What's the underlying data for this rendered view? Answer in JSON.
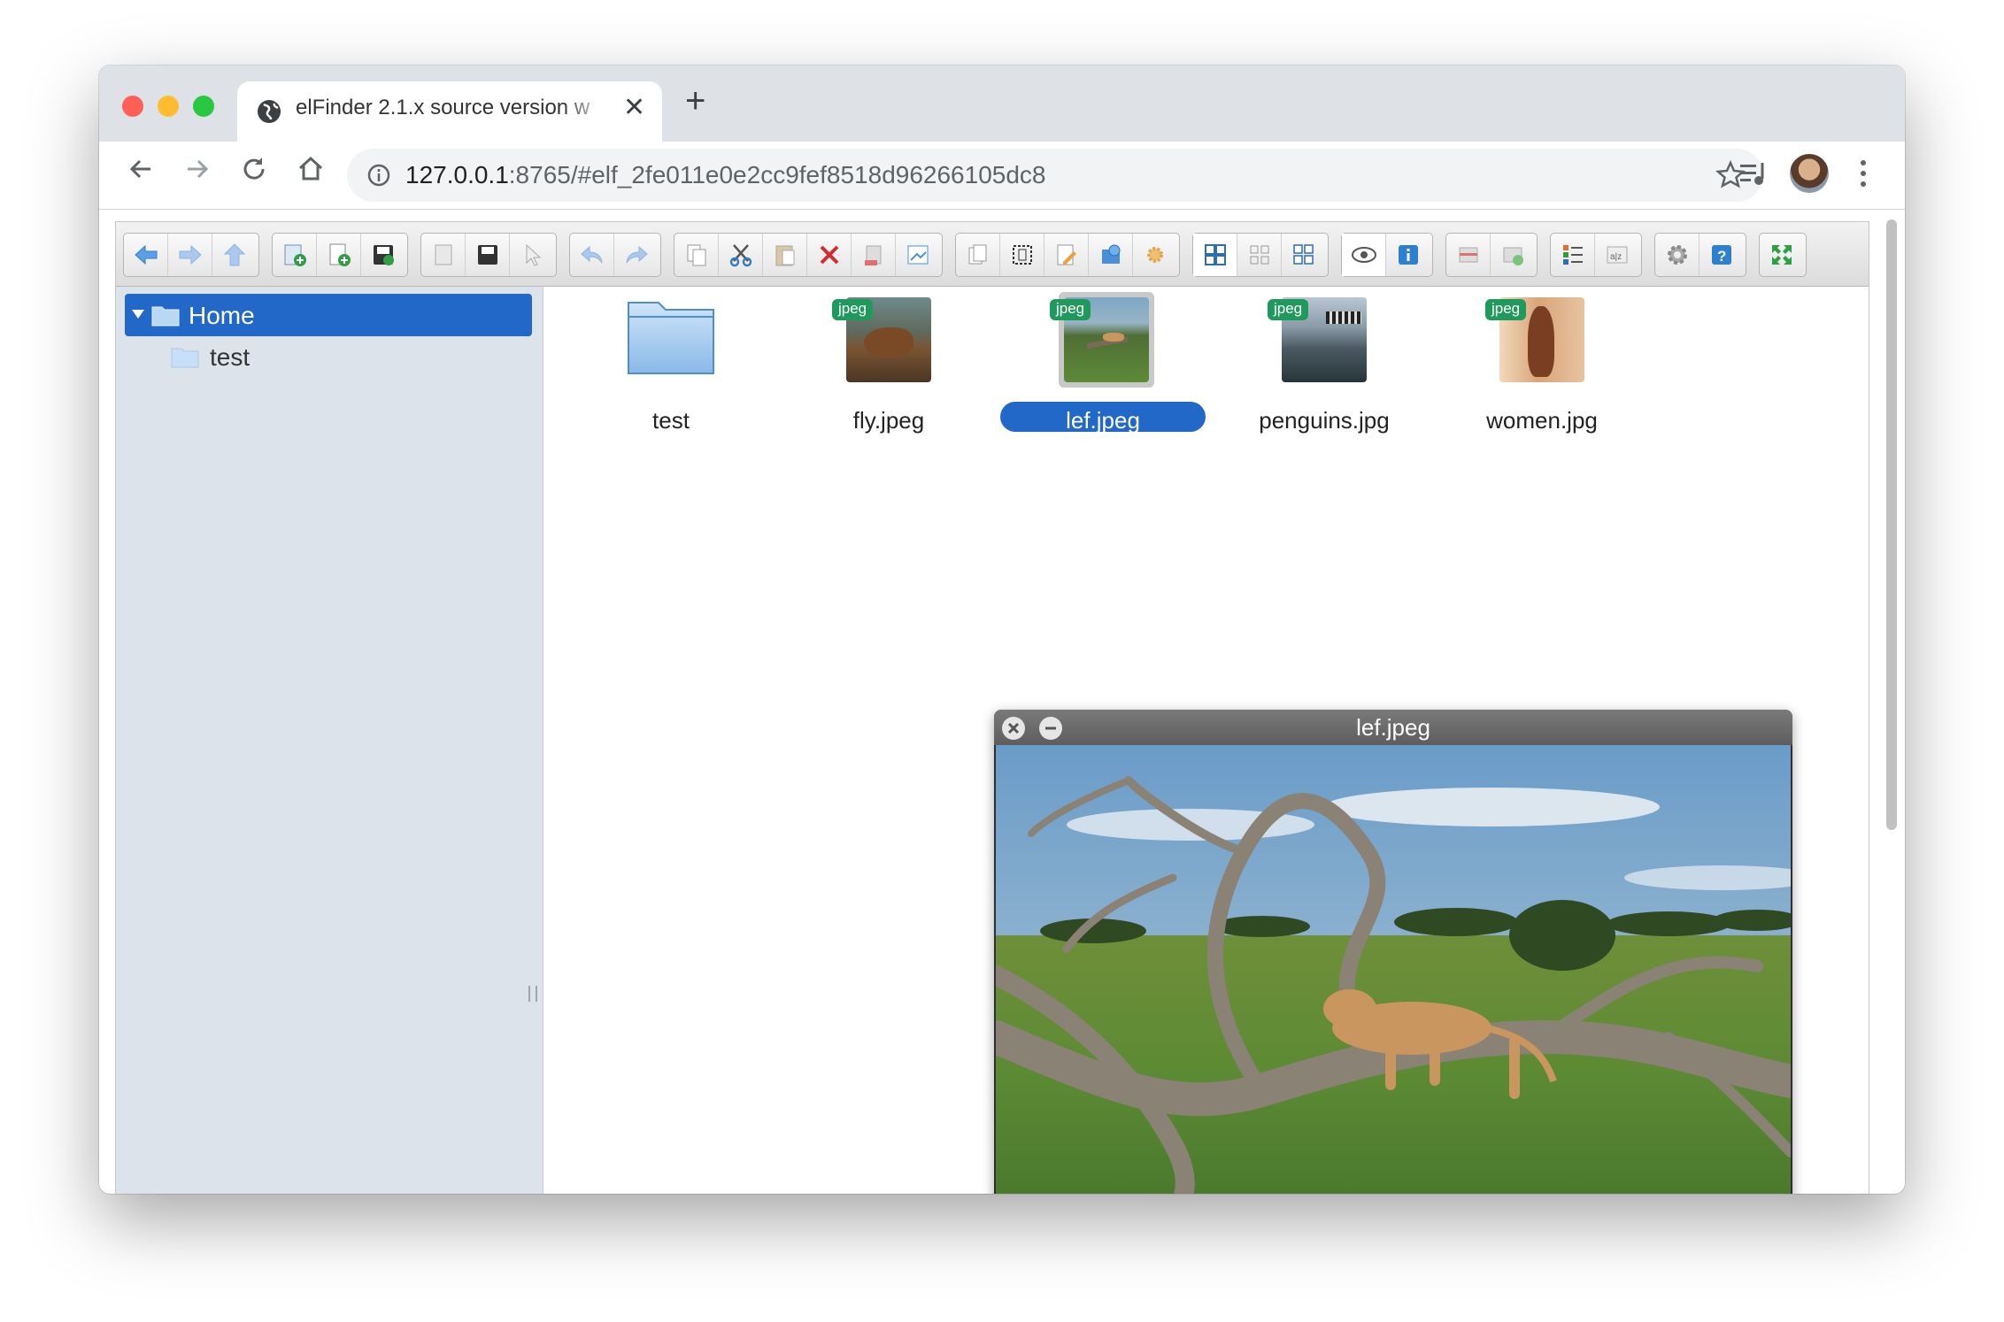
{
  "browser": {
    "tab_title": "elFinder 2.1.x source version w",
    "url_host": "127.0.0.1",
    "url_rest": ":8765/#elf_2fe011e0e2cc9fef8518d96266105dc8",
    "traffic_colors": [
      "#ff5f57",
      "#febc2e",
      "#28c840"
    ]
  },
  "toolbar": {
    "groups": [
      {
        "name": "history",
        "buttons": [
          "back-icon",
          "forward-icon",
          "up-icon"
        ]
      },
      {
        "name": "file",
        "buttons": [
          "mkdir-icon",
          "mkfile-icon",
          "upload-icon"
        ]
      },
      {
        "name": "open",
        "buttons": [
          "open-icon",
          "download-icon",
          "getfile-icon"
        ]
      },
      {
        "name": "undo",
        "buttons": [
          "undo-icon",
          "redo-icon"
        ]
      },
      {
        "name": "edit",
        "buttons": [
          "copy-icon",
          "cut-icon",
          "paste-icon",
          "delete-icon",
          "empty-icon",
          "hide-icon"
        ]
      },
      {
        "name": "tools",
        "buttons": [
          "duplicate-icon",
          "selectall-icon",
          "edit-icon",
          "netmount-icon",
          "resize-icon"
        ]
      },
      {
        "name": "view",
        "buttons": [
          "view-icons-icon",
          "view-small-icon",
          "view-list-icon"
        ]
      },
      {
        "name": "info",
        "buttons": [
          "quicklook-icon",
          "info-icon"
        ]
      },
      {
        "name": "archive",
        "buttons": [
          "extract-icon",
          "archive-icon"
        ]
      },
      {
        "name": "sort",
        "buttons": [
          "view-list-icon",
          "sort-icon"
        ]
      },
      {
        "name": "help",
        "buttons": [
          "preference-icon",
          "help-icon"
        ]
      },
      {
        "name": "fullscreen",
        "buttons": [
          "fullscreen-icon"
        ]
      }
    ]
  },
  "tree": {
    "root": "Home",
    "children": [
      "test"
    ]
  },
  "files": [
    {
      "name": "test",
      "type": "folder",
      "badge": ""
    },
    {
      "name": "fly.jpeg",
      "type": "image",
      "badge": "jpeg",
      "selected": false
    },
    {
      "name": "lef.jpeg",
      "type": "image",
      "badge": "jpeg",
      "selected": true
    },
    {
      "name": "penguins.jpg",
      "type": "image",
      "badge": "jpeg",
      "selected": false
    },
    {
      "name": "women.jpg",
      "type": "image",
      "badge": "jpeg",
      "selected": false
    }
  ],
  "quicklook": {
    "title": "lef.jpeg"
  },
  "colors": {
    "selection": "#2268c9",
    "badge": "#1f9a5c",
    "nav_bg": "#dce3eb"
  }
}
